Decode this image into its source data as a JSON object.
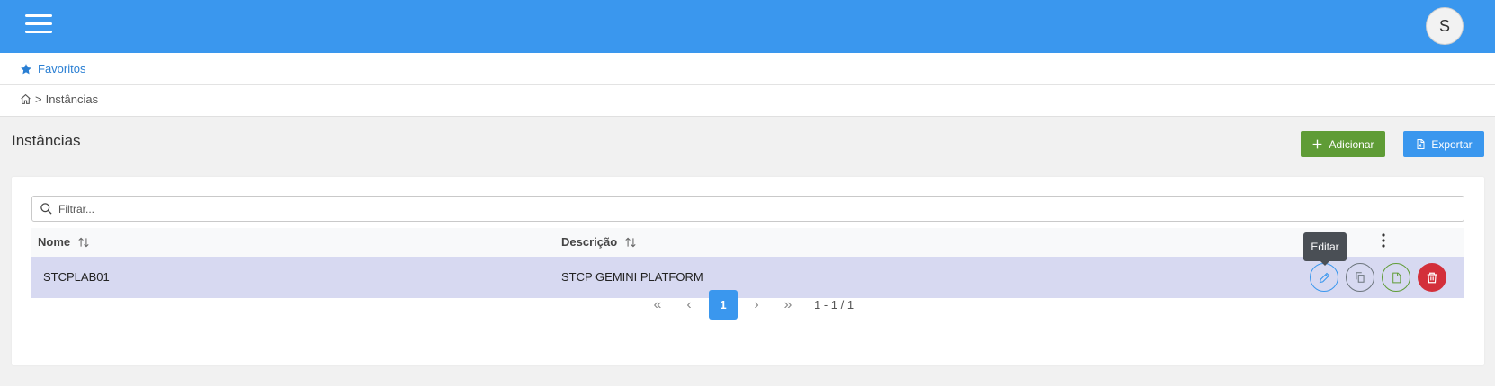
{
  "header": {
    "avatar_letter": "S"
  },
  "favorites": {
    "label": "Favoritos"
  },
  "breadcrumb": {
    "separator": ">",
    "current": "Instâncias"
  },
  "page": {
    "title": "Instâncias",
    "add_label": "Adicionar",
    "export_label": "Exportar"
  },
  "filter": {
    "placeholder": "Filtrar..."
  },
  "table": {
    "columns": [
      "Nome",
      "Descrição"
    ],
    "rows": [
      {
        "nome": "STCPLAB01",
        "descricao": "STCP GEMINI PLATFORM"
      }
    ]
  },
  "actions": {
    "tooltip": "Editar"
  },
  "pagination": {
    "current_page": "1",
    "info": "1 - 1 / 1"
  },
  "colors": {
    "primary": "#3a97ee",
    "success": "#5f9c36",
    "danger": "#d32f3a",
    "row_selected": "#d7d9f1"
  },
  "icons": [
    "menu-icon",
    "star-icon",
    "home-icon",
    "plus-icon",
    "file-excel-icon",
    "search-icon",
    "sort-icon",
    "more-vertical-icon",
    "pencil-icon",
    "copy-icon",
    "file-icon",
    "trash-icon"
  ]
}
